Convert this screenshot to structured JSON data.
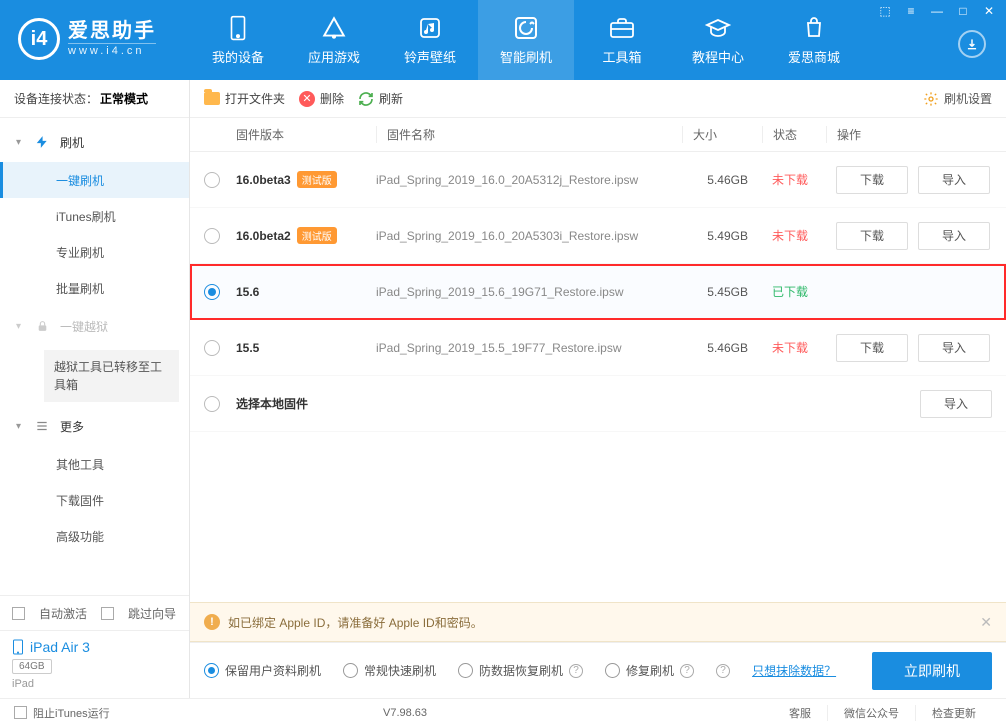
{
  "brand": {
    "name": "爱思助手",
    "url": "www.i4.cn"
  },
  "window_buttons": [
    "⬚",
    "≡",
    "—",
    "□",
    "✕"
  ],
  "tabs": [
    {
      "label": "我的设备",
      "icon": "device"
    },
    {
      "label": "应用游戏",
      "icon": "apps"
    },
    {
      "label": "铃声壁纸",
      "icon": "music"
    },
    {
      "label": "智能刷机",
      "icon": "flash"
    },
    {
      "label": "工具箱",
      "icon": "toolbox"
    },
    {
      "label": "教程中心",
      "icon": "tutorial"
    },
    {
      "label": "爱思商城",
      "icon": "store"
    }
  ],
  "active_tab": 3,
  "status_label": "设备连接状态：",
  "status_value": "正常模式",
  "side_nav": {
    "flash": {
      "label": "刷机",
      "items": [
        "一键刷机",
        "iTunes刷机",
        "专业刷机",
        "批量刷机"
      ],
      "selected": 0
    },
    "jailbreak": {
      "label": "一键越狱",
      "note": "越狱工具已转移至工具箱"
    },
    "more": {
      "label": "更多",
      "items": [
        "其他工具",
        "下载固件",
        "高级功能"
      ]
    }
  },
  "side_bottom": {
    "auto_activate": "自动激活",
    "skip_wizard": "跳过向导",
    "device_name": "iPad Air 3",
    "capacity": "64GB",
    "device_type": "iPad"
  },
  "toolbar": {
    "open": "打开文件夹",
    "delete": "删除",
    "refresh": "刷新",
    "settings": "刷机设置"
  },
  "columns": {
    "version": "固件版本",
    "name": "固件名称",
    "size": "大小",
    "status": "状态",
    "op": "操作"
  },
  "rows": [
    {
      "version": "16.0beta3",
      "beta": "测试版",
      "name": "iPad_Spring_2019_16.0_20A5312j_Restore.ipsw",
      "size": "5.46GB",
      "status": "未下载",
      "selected": false,
      "has_dl": true
    },
    {
      "version": "16.0beta2",
      "beta": "测试版",
      "name": "iPad_Spring_2019_16.0_20A5303i_Restore.ipsw",
      "size": "5.49GB",
      "status": "未下载",
      "selected": false,
      "has_dl": true
    },
    {
      "version": "15.6",
      "beta": "",
      "name": "iPad_Spring_2019_15.6_19G71_Restore.ipsw",
      "size": "5.45GB",
      "status": "已下载",
      "selected": true,
      "has_dl": false,
      "highlight": true
    },
    {
      "version": "15.5",
      "beta": "",
      "name": "iPad_Spring_2019_15.5_19F77_Restore.ipsw",
      "size": "5.46GB",
      "status": "未下载",
      "selected": false,
      "has_dl": true
    },
    {
      "version": "选择本地固件",
      "beta": "",
      "name": "",
      "size": "",
      "status": "",
      "selected": false,
      "has_dl": false,
      "import_only": true
    }
  ],
  "row_buttons": {
    "download": "下载",
    "import": "导入"
  },
  "notice": "如已绑定 Apple ID，请准备好 Apple ID和密码。",
  "flash_options": [
    "保留用户资料刷机",
    "常规快速刷机",
    "防数据恢复刷机",
    "修复刷机"
  ],
  "flash_selected": 0,
  "erase_link": "只想抹除数据？",
  "flash_button": "立即刷机",
  "footer": {
    "stop_itunes": "阻止iTunes运行",
    "version": "V7.98.63",
    "links": [
      "客服",
      "微信公众号",
      "检查更新"
    ]
  }
}
